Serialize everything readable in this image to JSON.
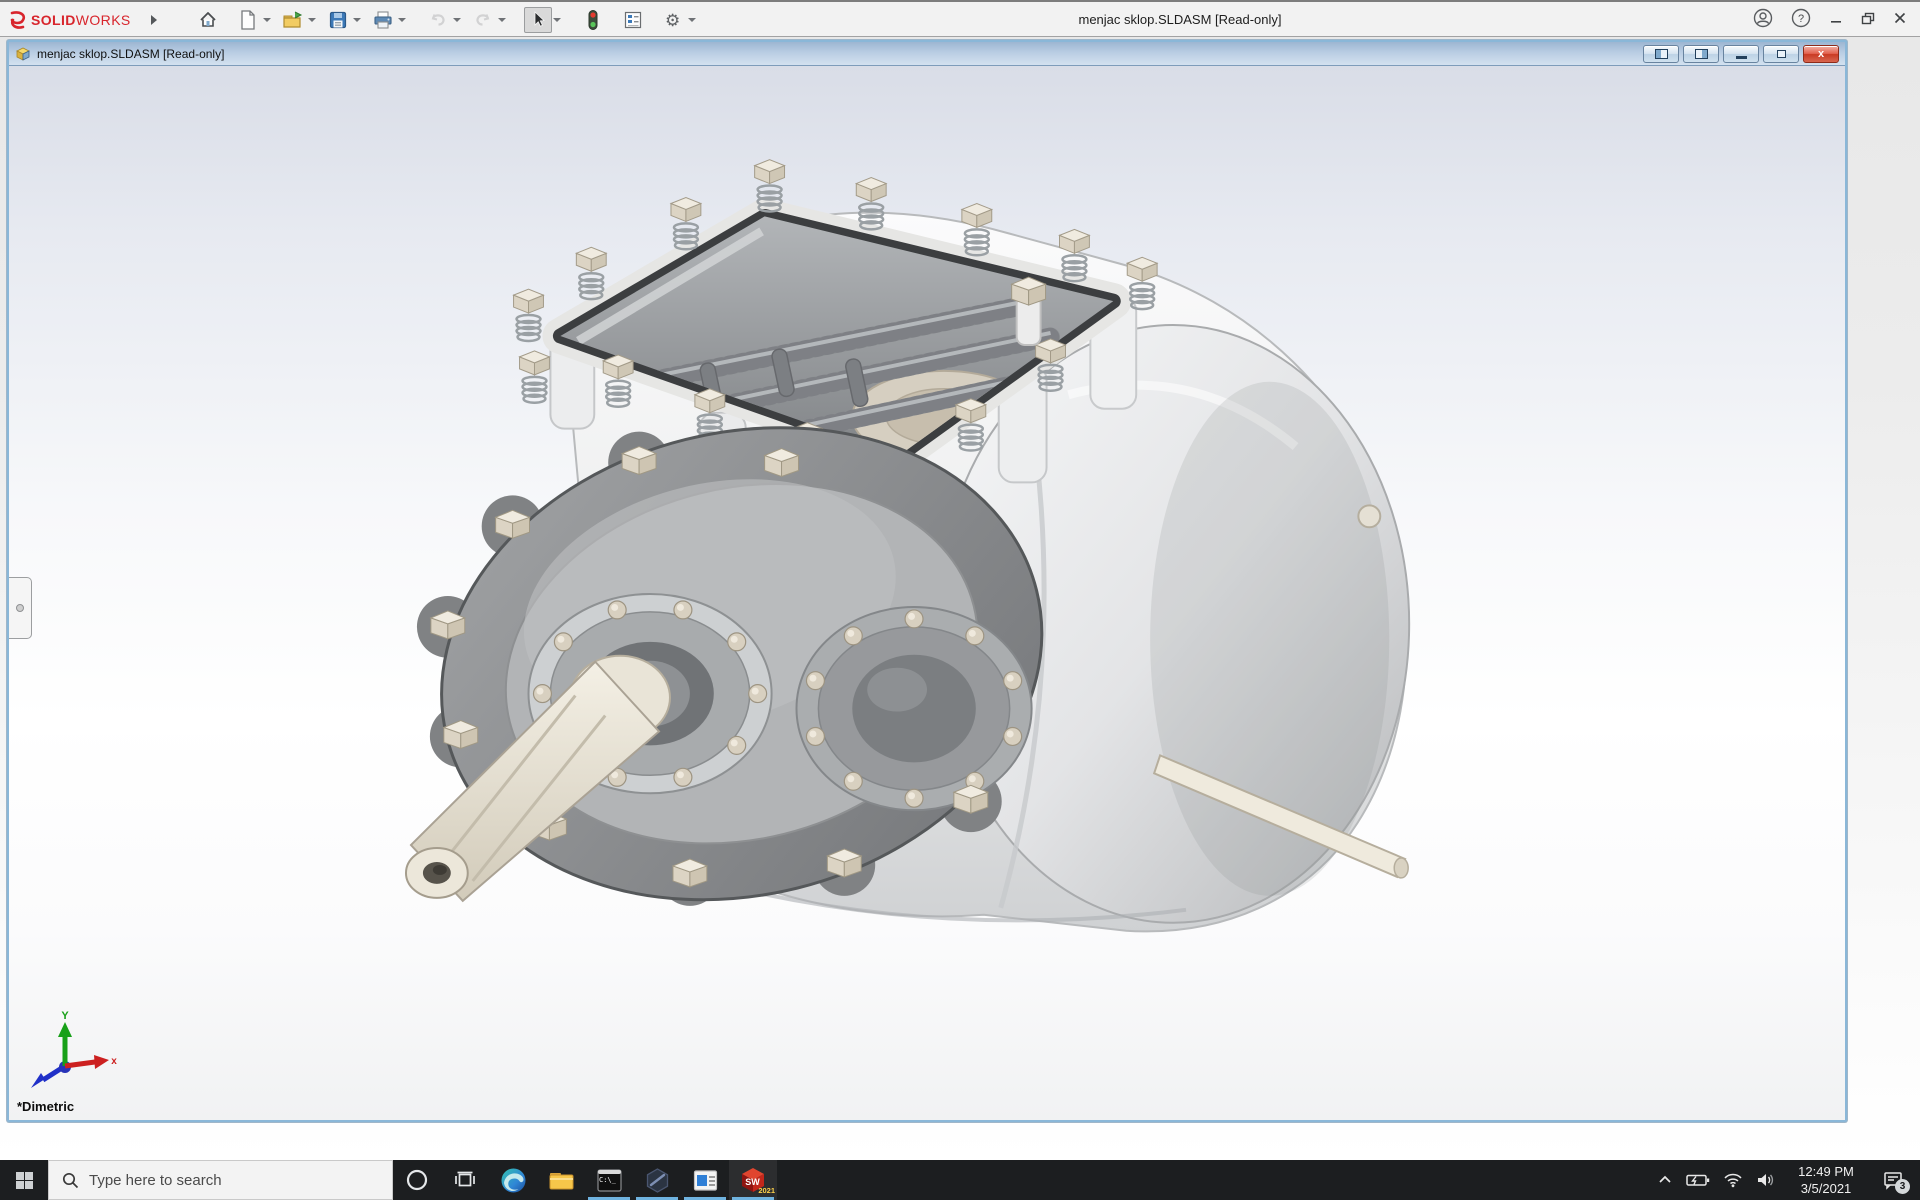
{
  "app": {
    "title": "menjac sklop.SLDASM [Read-only]",
    "brand_bold": "SOLID",
    "brand_light": "WORKS",
    "toolbar_icons": [
      "home",
      "new-document",
      "open",
      "save",
      "print",
      "undo",
      "redo",
      "select",
      "performance-monitor",
      "properties",
      "options"
    ],
    "titlebar_icons": [
      "account",
      "help",
      "minimize",
      "restore",
      "close"
    ]
  },
  "document": {
    "title": "menjac sklop.SLDASM [Read-only]",
    "window_controls": [
      "pane-left",
      "pane-right",
      "minimize",
      "restore",
      "close"
    ],
    "view_label": "*Dimetric",
    "triad": {
      "y_label": "Y",
      "x_label": "x"
    }
  },
  "taskbar": {
    "search_placeholder": "Type here to search",
    "pinned_icons": [
      "edge",
      "file-explorer",
      "command-prompt",
      "hexagon-app",
      "window-app",
      "solidworks-2021"
    ],
    "running_apps": [
      "command-prompt",
      "hexagon-app",
      "window-app",
      "solidworks-2021"
    ],
    "cmd_label": "C:\\_",
    "solidworks_letters": "SW",
    "solidworks_year": "2021",
    "tray": {
      "time": "12:49 PM",
      "date": "3/5/2021",
      "notification_count": "3"
    }
  }
}
